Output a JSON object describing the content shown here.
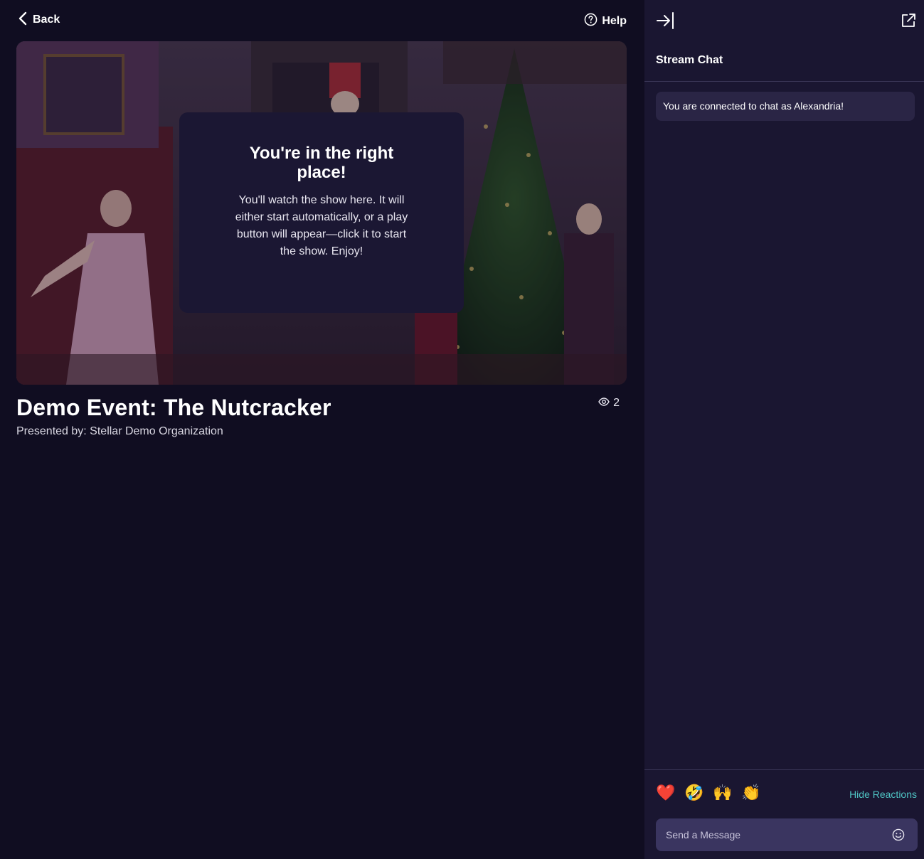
{
  "header": {
    "back_label": "Back",
    "help_label": "Help"
  },
  "overlay": {
    "title": "You're in the right place!",
    "body": "You'll watch the show here. It will either start automatically, or a play button will appear—click it to start the show. Enjoy!"
  },
  "event": {
    "title": "Demo Event: The Nutcracker",
    "presented_by": "Presented by: Stellar Demo Organization",
    "viewer_count": "2"
  },
  "chat": {
    "title": "Stream Chat",
    "system_message": "You are connected to chat as Alexandria!",
    "reactions": [
      {
        "name": "heart",
        "glyph": "❤️"
      },
      {
        "name": "rofl",
        "glyph": "🤣"
      },
      {
        "name": "raised-hands",
        "glyph": "🙌"
      },
      {
        "name": "clapping-hands",
        "glyph": "👏"
      }
    ],
    "hide_reactions_label": "Hide Reactions",
    "input_placeholder": "Send a Message"
  },
  "colors": {
    "background": "#100d21",
    "sidebar": "#1a1631",
    "accent_teal": "#4fc4c4",
    "card": "#1b1733"
  }
}
